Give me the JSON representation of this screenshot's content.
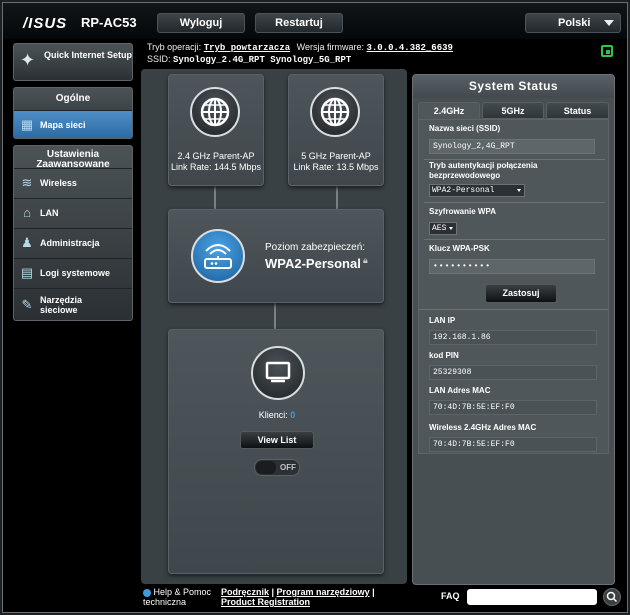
{
  "header": {
    "brand": "/ISUS",
    "model": "RP-AC53",
    "logout_label": "Wyloguj",
    "restart_label": "Restartuj",
    "language": "Polski"
  },
  "info": {
    "mode_label": "Tryb operacji:",
    "mode_value": "Tryb powtarzacza",
    "fw_label": "Wersja firmware:",
    "fw_value": "3.0.0.4.382_6639",
    "ssid_label": "SSID:",
    "ssid_values": "Synology_2.4G_RPT  Synology_5G_RPT"
  },
  "sidebar": {
    "qis_label": "Quick Internet Setup",
    "general_heading": "Ogólne",
    "general_items": [
      {
        "label": "Mapa sieci",
        "icon": "network-map-icon"
      }
    ],
    "advanced_heading": "Ustawienia Zaawansowane",
    "advanced_items": [
      {
        "label": "Wireless",
        "icon": "wifi-icon"
      },
      {
        "label": "LAN",
        "icon": "home-icon"
      },
      {
        "label": "Administracja",
        "icon": "admin-icon"
      },
      {
        "label": "Logi systemowe",
        "icon": "log-icon"
      },
      {
        "label": "Narzędzia sieciowe",
        "icon": "tools-icon"
      }
    ]
  },
  "map": {
    "ap24_name": "2.4 GHz Parent-AP",
    "ap24_rate": "Link Rate: 144.5 Mbps",
    "ap5_name": "5 GHz Parent-AP",
    "ap5_rate": "Link Rate: 13.5 Mbps",
    "security_label": "Poziom zabezpieczeń:",
    "security_value": "WPA2-Personal",
    "clients_label": "Klienci:",
    "clients_count": "0",
    "view_list_label": "View List",
    "toggle_label": "OFF"
  },
  "status": {
    "title": "System Status",
    "tabs": [
      "2.4GHz",
      "5GHz",
      "Status"
    ],
    "ssid_label": "Nazwa sieci (SSID)",
    "ssid_value": "Synology_2,4G_RPT",
    "auth_label": "Tryb autentykacji połączenia bezprzewodowego",
    "auth_value": "WPA2-Personal",
    "enc_label": "Szyfrowanie WPA",
    "enc_value": "AES",
    "psk_label": "Klucz WPA-PSK",
    "psk_value": "••••••••••",
    "apply_label": "Zastosuj",
    "lan_ip_label": "LAN IP",
    "lan_ip_value": "192.168.1.86",
    "pin_label": "kod PIN",
    "pin_value": "25329308",
    "lan_mac_label": "LAN Adres MAC",
    "lan_mac_value": "70:4D:7B:5E:EF:F0",
    "wmac_label": "Wireless 2.4GHz Adres MAC",
    "wmac_value": "70:4D:7B:5E:EF:F0"
  },
  "footer": {
    "help_label": "Help & Pomoc techniczna",
    "manual_link": "Podręcznik",
    "utility_link": "Program narzędziowy",
    "registration_link": "Product Registration",
    "faq_label": "FAQ"
  }
}
